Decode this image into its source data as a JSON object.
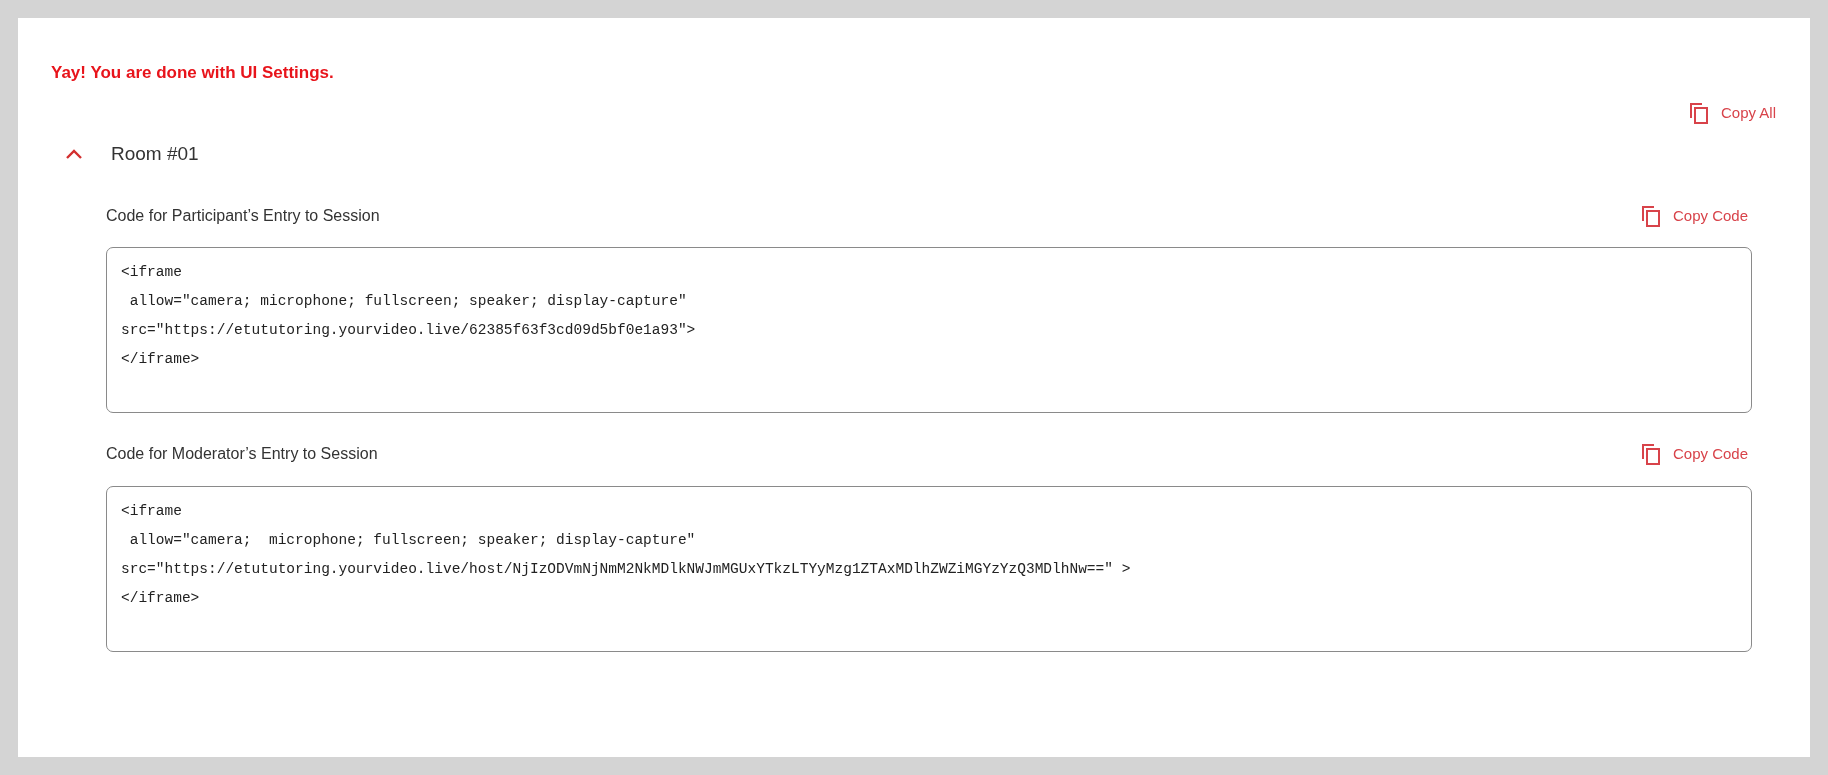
{
  "message": "Yay! You are done with UI Settings.",
  "copy_all": {
    "label": "Copy All"
  },
  "rooms": [
    {
      "title": "Room #01",
      "expanded": true,
      "codes": [
        {
          "label": "Code for Participant’s Entry to Session",
          "copy_label": "Copy Code",
          "lines": [
            "<iframe",
            " allow=\"camera; microphone; fullscreen; speaker; display-capture\"",
            "src=\"https://etututoring.yourvideo.live/62385f63f3cd09d5bf0e1a93\">",
            "</iframe>"
          ]
        },
        {
          "label": "Code for Moderator’s Entry to Session",
          "copy_label": "Copy Code",
          "lines": [
            "<iframe",
            " allow=\"camera;  microphone; fullscreen; speaker; display-capture\"",
            "src=\"https://etututoring.yourvideo.live/host/NjIzODVmNjNmM2NkMDlkNWJmMGUxYTkzLTYyMzg1ZTAxMDlhZWZiMGYzYzQ3MDlhNw==\" >",
            "</iframe>"
          ]
        }
      ]
    }
  ]
}
